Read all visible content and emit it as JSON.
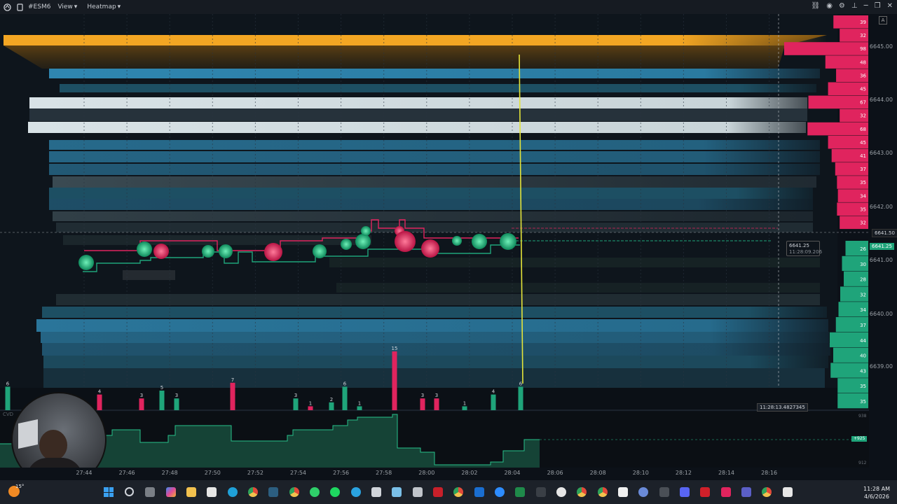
{
  "window": {
    "symbol": "#ESM6",
    "menu_view": "View",
    "menu_heatmap": "Heatmap"
  },
  "price_axis": {
    "labels": [
      "6645.00",
      "6644.00",
      "6643.00",
      "6642.00",
      "6641.00",
      "6640.00",
      "6639.00"
    ],
    "current_price_tag": "6641.50",
    "bid_price_tag": "6641.25"
  },
  "dom_sizes_ask": [
    "39",
    "32",
    "98",
    "48",
    "36",
    "45",
    "67",
    "32",
    "68",
    "45",
    "41",
    "37",
    "35",
    "34",
    "35",
    "32"
  ],
  "dom_sizes_bid": [
    "26",
    "30",
    "28",
    "32",
    "34",
    "37",
    "44",
    "40",
    "43",
    "35",
    "35"
  ],
  "time_axis": [
    "27:44",
    "27:46",
    "27:48",
    "27:50",
    "27:52",
    "27:54",
    "27:56",
    "27:58",
    "28:00",
    "28:02",
    "28:04",
    "28:06",
    "28:08",
    "28:10",
    "28:12",
    "28:14",
    "28:16"
  ],
  "crosshair": {
    "price": "6641.25",
    "time": "11:28:09.206",
    "time_label": "11:28:13.4827345"
  },
  "volume_bars": [
    {
      "label": "6",
      "value": 6,
      "color": "green"
    },
    {
      "label": "4",
      "value": 4,
      "color": "red"
    },
    {
      "label": "3",
      "value": 3,
      "color": "red"
    },
    {
      "label": "5",
      "value": 5,
      "color": "green"
    },
    {
      "label": "3",
      "value": 3,
      "color": "green"
    },
    {
      "label": "7",
      "value": 7,
      "color": "red"
    },
    {
      "label": "3",
      "value": 3,
      "color": "green"
    },
    {
      "label": "1",
      "value": 1,
      "color": "red"
    },
    {
      "label": "2",
      "value": 2,
      "color": "green"
    },
    {
      "label": "6",
      "value": 6,
      "color": "green"
    },
    {
      "label": "1",
      "value": 1,
      "color": "green"
    },
    {
      "label": "15",
      "value": 15,
      "color": "red"
    },
    {
      "label": "3",
      "value": 3,
      "color": "red"
    },
    {
      "label": "3",
      "value": 3,
      "color": "red"
    },
    {
      "label": "1",
      "value": 1,
      "color": "green"
    },
    {
      "label": "4",
      "value": 4,
      "color": "green"
    },
    {
      "label": "6",
      "value": 6,
      "color": "green"
    }
  ],
  "cvd": {
    "label": "CVD",
    "top_value": "938",
    "current_value": "+925",
    "bottom_value": "912"
  },
  "taskbar": {
    "weather_temp": "15°",
    "time": "11:28 AM",
    "date": "4/6/2026"
  },
  "colors": {
    "bid_green": "#1fa47a",
    "ask_red": "#e0245e",
    "crosshair_yellow": "#e4e43a",
    "heat_orange": "#f0a020",
    "heat_blue": "#2f86b0",
    "heat_white": "#cfd8dc"
  }
}
